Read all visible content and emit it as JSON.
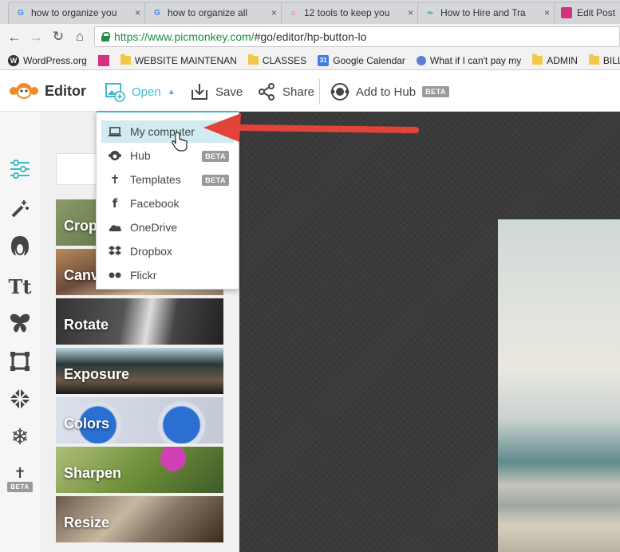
{
  "browser": {
    "tabs": [
      {
        "title": "how to organize you",
        "fav": "G",
        "color": "#4285f4"
      },
      {
        "title": "how to organize all",
        "fav": "G",
        "color": "#4285f4"
      },
      {
        "title": "12 tools to keep you",
        "fav": "⌂",
        "color": "#e8553e"
      },
      {
        "title": "How to Hire and Tra",
        "fav": "∞",
        "color": "#3aa36a"
      },
      {
        "title": "Edit Post",
        "fav": "",
        "color": "#d6307f"
      }
    ],
    "url_secure": "https://www.picmonkey.com/",
    "url_rest": "#go/editor/hp-button-lo",
    "bookmarks": [
      {
        "label": "WordPress.org",
        "icon": "wordpress-icon"
      },
      {
        "label": "",
        "icon": "pink-square-icon"
      },
      {
        "label": "WEBSITE MAINTENAN",
        "icon": "folder-icon"
      },
      {
        "label": "CLASSES",
        "icon": "folder-icon"
      },
      {
        "label": "Google Calendar",
        "icon": "calendar-icon"
      },
      {
        "label": "What if I can't pay my",
        "icon": "circle-icon"
      },
      {
        "label": "ADMIN",
        "icon": "folder-icon"
      },
      {
        "label": "BILLS",
        "icon": "folder-icon"
      }
    ],
    "calendar_day": "31"
  },
  "toolbar": {
    "app_name": "Editor",
    "open_label": "Open",
    "save_label": "Save",
    "share_label": "Share",
    "hub_label": "Add to Hub",
    "beta_label": "BETA"
  },
  "open_menu": {
    "items": [
      {
        "label": "My computer",
        "icon": "laptop-icon",
        "beta": false
      },
      {
        "label": "Hub",
        "icon": "hub-icon",
        "beta": true
      },
      {
        "label": "Templates",
        "icon": "templates-icon",
        "beta": true
      },
      {
        "label": "Facebook",
        "icon": "facebook-icon",
        "beta": false
      },
      {
        "label": "OneDrive",
        "icon": "onedrive-icon",
        "beta": false
      },
      {
        "label": "Dropbox",
        "icon": "dropbox-icon",
        "beta": false
      },
      {
        "label": "Flickr",
        "icon": "flickr-icon",
        "beta": false
      }
    ],
    "beta_label": "BETA"
  },
  "rail": {
    "icons": [
      "adjustments-icon",
      "effects-wand-icon",
      "touch-up-face-icon",
      "text-icon",
      "overlays-butterfly-icon",
      "frames-icon",
      "textures-icon",
      "themes-snowflake-icon",
      "templates-beta-icon"
    ],
    "beta_label": "BETA"
  },
  "panel": {
    "tiles": [
      {
        "label": "Crop",
        "bg": "linear-gradient(135deg,#8a9a6a,#5a6f3f 60%,#c4b892)"
      },
      {
        "label": "Canvas",
        "bg": "linear-gradient(160deg,#b98a5a,#6a4a3a 40%,#d9c2a0 70%,#8a7a6a)"
      },
      {
        "label": "Rotate",
        "bg": "linear-gradient(100deg,#333,#555 40%,#ddd 55%,#444 70%,#222)"
      },
      {
        "label": "Exposure",
        "bg": "linear-gradient(180deg,#bcd4e0,#2a3a3a 35%,#6b5a4a 70%,#1a1a1a)"
      },
      {
        "label": "Colors",
        "bg": "radial-gradient(circle at 25% 60%,#2a6fd1 0 14%,#d9dee8 15% 18%,transparent 19%),radial-gradient(circle at 75% 60%,#2a6fd1 0 14%,#d9dee8 15% 18%,transparent 19%),linear-gradient(90deg,#d9e0ea,#c3cad6)"
      },
      {
        "label": "Sharpen",
        "bg": "radial-gradient(circle at 70% 25%,#d13fb7 0 10%,transparent 11%),linear-gradient(135deg,#aebf7a,#6f8f3a 50%,#3f5a2a)"
      },
      {
        "label": "Resize",
        "bg": "linear-gradient(135deg,#6a5a4a,#c9b8a0 40%,#8a7a6a 60%,#3a2a1a)"
      }
    ]
  },
  "colors": {
    "accent": "#3fb9c8",
    "arrow": "#e2443a",
    "logo": "#f28a2b"
  }
}
